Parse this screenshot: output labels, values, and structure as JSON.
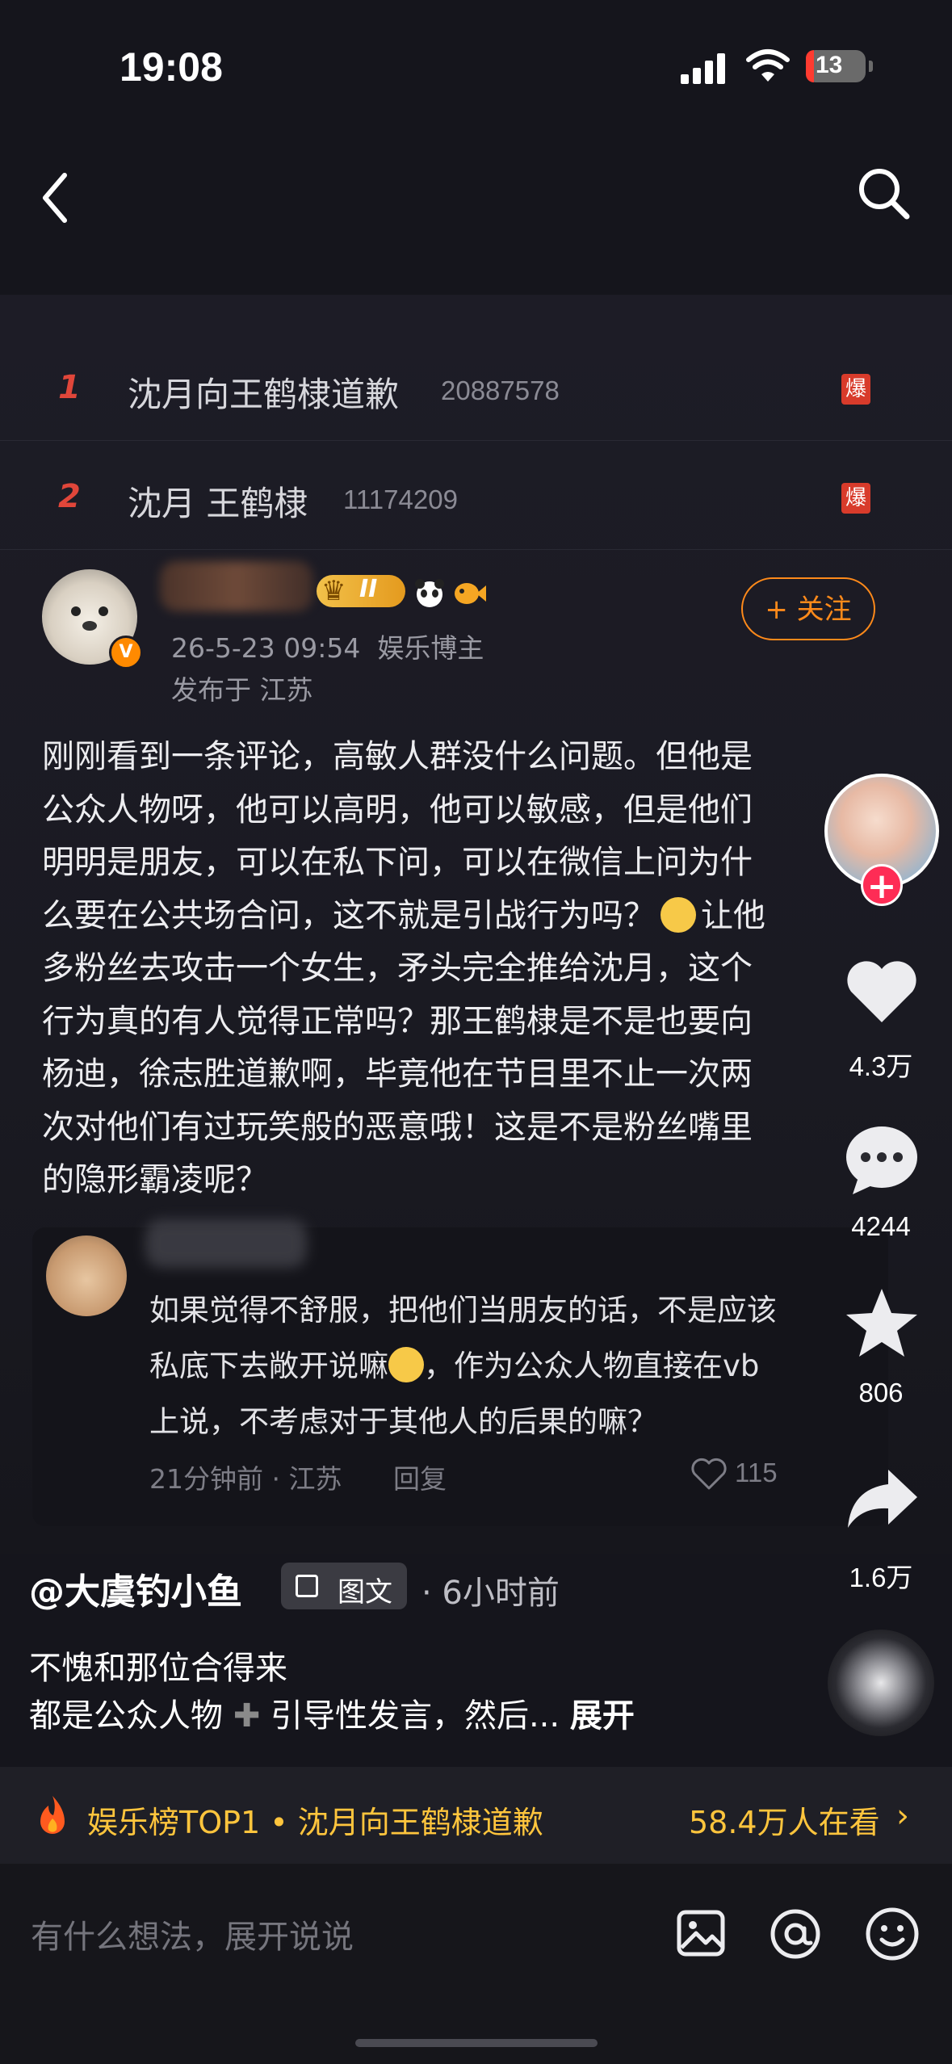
{
  "status_bar": {
    "time": "19:08",
    "battery_level": "13"
  },
  "nav": {
    "back_icon": "chevron-left-icon",
    "search_icon": "search-icon"
  },
  "hot_list": [
    {
      "rank": "1",
      "title": "沈月向王鹤棣道歉",
      "count": "20887578",
      "badge": "爆"
    },
    {
      "rank": "2",
      "title": "沈月 王鹤棣",
      "count": "11174209",
      "badge": "爆"
    }
  ],
  "post": {
    "level": "II",
    "timestamp": "26-5-23 09:54",
    "role": "娱乐博主",
    "location": "发布于 江苏",
    "follow_label": "+ 关注",
    "verified_mark": "V",
    "body_lines": [
      "刚刚看到一条评论，高敏人群没什么问题。但他是",
      "公众人物呀，他可以高明，他可以敏感，但是他们",
      "明明是朋友，可以在私下问，可以在微信上问为什",
      "么要在公共场合问，这不就是引战行为吗？",
      "让他",
      "多粉丝去攻击一个女生，矛头完全推给沈月，这个",
      "行为真的有人觉得正常吗？那王鹤棣是不是也要向",
      "杨迪，徐志胜道歉啊，毕竟他在节目里不止一次两",
      "次对他们有过玩笑般的恶意哦！这是不是粉丝嘴里",
      "的隐形霸凌呢？"
    ]
  },
  "reply": {
    "text_line1": "如果觉得不舒服，把他们当朋友的话，不是应该",
    "text_line2a": "私底下去敞开说嘛",
    "text_line2b": "，作为公众人物直接在vb",
    "text_line3": "上说，不考虑对于其他人的后果的嘛？",
    "meta": "21分钟前 · 江苏",
    "reply_label": "回复",
    "like_count": "115"
  },
  "rail": {
    "like_count": "4.3万",
    "comment_count": "4244",
    "favorite_count": "806",
    "share_count": "1.6万"
  },
  "caption": {
    "handle": "@大虞钓小鱼",
    "type_label": "图文",
    "time": "· 6小时前",
    "line1": "不愧和那位合得来",
    "line2_a": "都是公众人物",
    "line2_b": "引导性发言，然后...",
    "expand_label": "展开"
  },
  "trending": {
    "text": "娱乐榜TOP1 • 沈月向王鹤棣道歉",
    "viewers": "58.4万人在看",
    "arrow": "›"
  },
  "comment_bar": {
    "placeholder": "有什么想法，展开说说"
  },
  "colors": {
    "accent": "#fe2c55",
    "trend": "#ffc53d",
    "follow": "#ff8a1a",
    "hot_rank": "#e0463a"
  }
}
